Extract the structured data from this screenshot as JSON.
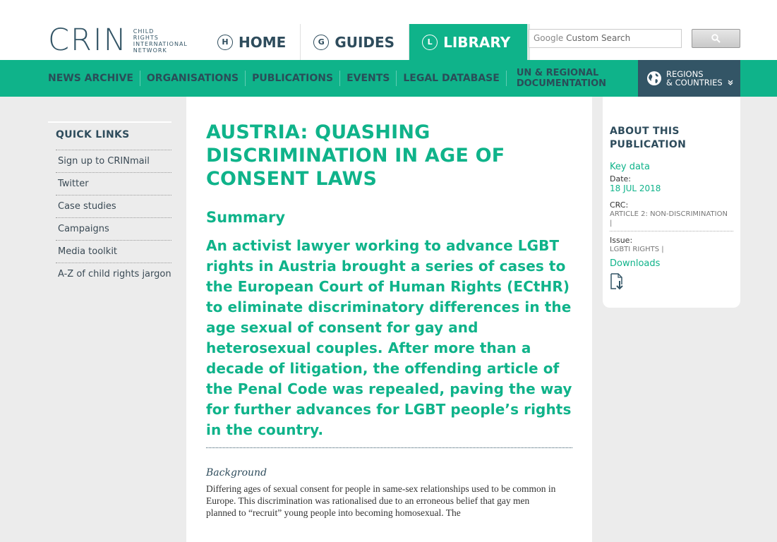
{
  "logo": {
    "mark": "CRIN",
    "lines": [
      "CHILD",
      "RIGHTS",
      "INTERNATIONAL",
      "NETWORK"
    ]
  },
  "mainnav": [
    {
      "letter": "H",
      "label": "HOME"
    },
    {
      "letter": "G",
      "label": "GUIDES"
    },
    {
      "letter": "L",
      "label": "LIBRARY"
    }
  ],
  "search": {
    "placeholder_google": "Google",
    "placeholder_rest": "Custom Search"
  },
  "subnav": [
    "NEWS ARCHIVE",
    "ORGANISATIONS",
    "PUBLICATIONS",
    "EVENTS",
    "LEGAL DATABASE"
  ],
  "subnav_multi": [
    "UN & REGIONAL",
    "DOCUMENTATION"
  ],
  "regions": [
    "REGIONS",
    "& COUNTRIES"
  ],
  "quick_links": {
    "title": "QUICK LINKS",
    "items": [
      "Sign up to CRINmail",
      "Twitter",
      "Case studies",
      "Campaigns",
      "Media toolkit",
      "A-Z of child rights jargon"
    ]
  },
  "article": {
    "title": "AUSTRIA: QUASHING DISCRIMINATION IN AGE OF CONSENT LAWS",
    "summary_heading": "Summary",
    "summary": "An activist lawyer working to advance LGBT rights in Austria brought a series of cases to the European Court of Human Rights (ECtHR) to eliminate discriminatory differences in the age sexual of consent for gay and heterosexual couples. After more than a decade of litigation, the offending article of the Penal Code was repealed, paving the way for further advances for LGBT people’s rights in the country.",
    "background_heading": "Background",
    "background": "Differing ages of sexual consent for people in same-sex relationships used to be common in Europe. This discrimination was rationalised due to an erroneous belief that gay men planned to “recruit” young people into becoming homosexual. The"
  },
  "about": {
    "title_line1": "ABOUT THIS",
    "title_line2": "PUBLICATION",
    "key_data": "Key data",
    "date_label": "Date:",
    "date": "18 JUL 2018",
    "crc_label": "CRC:",
    "crc": "ARTICLE 2: NON-DISCRIMINATION",
    "issue_label": "Issue:",
    "issue": "LGBTI RIGHTS",
    "downloads": "Downloads"
  },
  "colors": {
    "accent": "#0fb38a",
    "navy": "#335566",
    "bg": "#ececec"
  }
}
